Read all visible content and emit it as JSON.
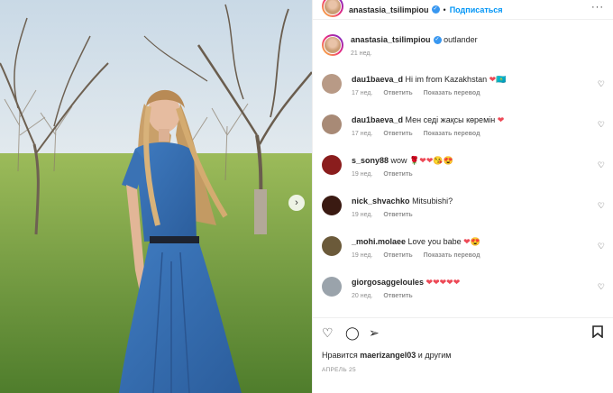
{
  "post": {
    "username": "anastasia_tsilimpiou",
    "follow_label": "Подписаться",
    "dot": "•",
    "more": "···",
    "caption_text": "outlander",
    "caption_time": "21 нед."
  },
  "comments": [
    {
      "user": "dau1baeva_d",
      "text": "Hi im from Kazakhstan",
      "emoji": "❤🇰🇿",
      "time": "17 нед.",
      "reply": "Ответить",
      "translate": "Показать перевод",
      "avatar_color": "#b89a86"
    },
    {
      "user": "dau1baeva_d",
      "text": "Мен седі жақсы көремін",
      "emoji": "❤",
      "time": "17 нед.",
      "reply": "Ответить",
      "translate": "Показать перевод",
      "avatar_color": "#a88a76"
    },
    {
      "user": "s_sony88",
      "text": "wow",
      "emoji": "🌹❤❤😘😍",
      "time": "19 нед.",
      "reply": "Ответить",
      "translate": "",
      "avatar_color": "#8a1d1d"
    },
    {
      "user": "nick_shvachko",
      "text": "Mitsubishi?",
      "emoji": "",
      "time": "19 нед.",
      "reply": "Ответить",
      "translate": "",
      "avatar_color": "#3a1a12"
    },
    {
      "user": "_mohi.molaee",
      "text": "Love you babe",
      "emoji": "❤😍",
      "time": "19 нед.",
      "reply": "Ответить",
      "translate": "Показать перевод",
      "avatar_color": "#6b5a3a"
    },
    {
      "user": "giorgosaggeloules",
      "text": "",
      "emoji": "❤❤❤❤❤",
      "time": "20 нед.",
      "reply": "Ответить",
      "translate": "",
      "avatar_color": "#9aa3ab"
    }
  ],
  "actions": {
    "like_icon": "heart-outline-icon",
    "comment_icon": "comment-icon",
    "share_icon": "paper-plane-icon",
    "save_icon": "bookmark-icon"
  },
  "likes_prefix": "Нравится",
  "likes_user": "maerizangel03",
  "likes_suffix": "и другим",
  "date": "АПРЕЛЬ 25",
  "colors": {
    "accent": "#0095f6",
    "heart": "#ed4956",
    "verified": "#3897f0"
  }
}
